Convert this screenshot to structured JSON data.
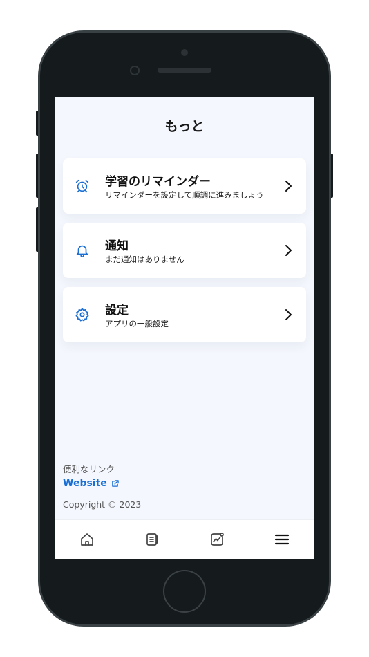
{
  "header": {
    "title": "もっと"
  },
  "menu": {
    "items": [
      {
        "title": "学習のリマインダー",
        "subtitle": "リマインダーを設定して順調に進みましょう",
        "icon": "alarm-clock-icon"
      },
      {
        "title": "通知",
        "subtitle": "まだ通知はありません",
        "icon": "bell-icon"
      },
      {
        "title": "設定",
        "subtitle": "アプリの一般設定",
        "icon": "gear-icon"
      }
    ]
  },
  "footer": {
    "links_label": "便利なリンク",
    "website_label": "Website",
    "copyright": "Copyright © 2023"
  },
  "tabbar": {
    "items": [
      {
        "icon": "home-icon",
        "active": false
      },
      {
        "icon": "notes-icon",
        "active": false
      },
      {
        "icon": "progress-chart-icon",
        "active": false
      },
      {
        "icon": "menu-icon",
        "active": true
      }
    ]
  },
  "colors": {
    "accent": "#1a6fd4",
    "background": "#f4f7fd",
    "card": "#ffffff",
    "frame": "#151a1c"
  }
}
